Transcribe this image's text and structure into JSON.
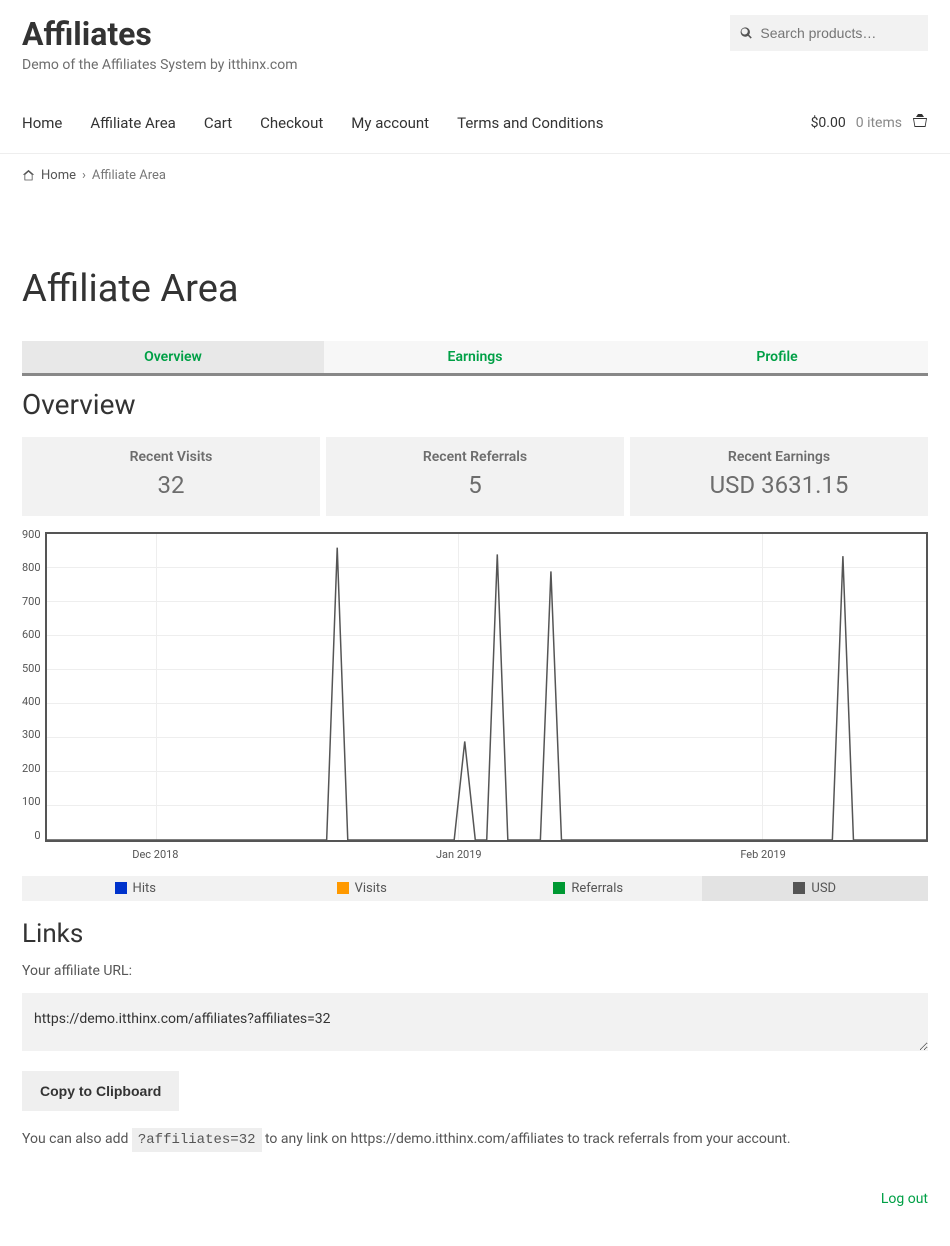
{
  "site": {
    "title": "Affiliates",
    "tagline": "Demo of the Affiliates System by itthinx.com"
  },
  "search": {
    "placeholder": "Search products…"
  },
  "nav": {
    "items": [
      "Home",
      "Affiliate Area",
      "Cart",
      "Checkout",
      "My account",
      "Terms and Conditions"
    ],
    "cart_total": "$0.00",
    "cart_items": "0 items"
  },
  "breadcrumb": {
    "home": "Home",
    "current": "Affiliate Area"
  },
  "page": {
    "title": "Affiliate Area"
  },
  "tabs": [
    "Overview",
    "Earnings",
    "Profile"
  ],
  "overview": {
    "title": "Overview",
    "stats": [
      {
        "label": "Recent Visits",
        "value": "32"
      },
      {
        "label": "Recent Referrals",
        "value": "5"
      },
      {
        "label": "Recent Earnings",
        "value": "USD 3631.15"
      }
    ]
  },
  "chart_data": {
    "type": "line",
    "ylim": [
      0,
      900
    ],
    "yticks": [
      0,
      100,
      200,
      300,
      400,
      500,
      600,
      700,
      800,
      900
    ],
    "x_range_days": 90,
    "x_ticks": [
      {
        "label": "Dec 2018",
        "pos": 0.124
      },
      {
        "label": "Jan 2019",
        "pos": 0.468
      },
      {
        "label": "Feb 2019",
        "pos": 0.813
      }
    ],
    "series": [
      {
        "name": "Hits",
        "color": "#0033cc",
        "active": false,
        "points": []
      },
      {
        "name": "Visits",
        "color": "#ff9900",
        "active": false,
        "points": []
      },
      {
        "name": "Referrals",
        "color": "#009933",
        "active": false,
        "points": []
      },
      {
        "name": "USD",
        "color": "#555555",
        "active": true,
        "points": [
          {
            "x": 0.33,
            "y": 860
          },
          {
            "x": 0.475,
            "y": 290
          },
          {
            "x": 0.512,
            "y": 840
          },
          {
            "x": 0.573,
            "y": 790
          },
          {
            "x": 0.905,
            "y": 835
          }
        ]
      }
    ],
    "legend": [
      "Hits",
      "Visits",
      "Referrals",
      "USD"
    ]
  },
  "links": {
    "title": "Links",
    "label": "Your affiliate URL:",
    "url": "https://demo.itthinx.com/affiliates?affiliates=32",
    "copy_label": "Copy to Clipboard",
    "append_pre": "You can also add ",
    "append_code": "?affiliates=32",
    "append_post": " to any link on https://demo.itthinx.com/affiliates to track referrals from your account."
  },
  "logout": "Log out"
}
